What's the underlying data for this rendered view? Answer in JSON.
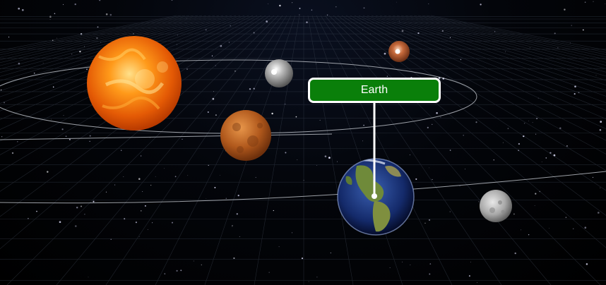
{
  "label": {
    "text": "Earth"
  },
  "colors": {
    "label_background": "#0a7f0a",
    "label_border": "#ffffff",
    "leader_line": "#ffffff",
    "orbit": "#cfd3da",
    "grid": "#3a4250",
    "space": "#000000"
  },
  "bodies": [
    {
      "name": "sun",
      "icon": "sun-icon"
    },
    {
      "name": "mercury",
      "icon": "planet-mercury-icon"
    },
    {
      "name": "venus",
      "icon": "planet-venus-icon"
    },
    {
      "name": "earth",
      "icon": "planet-earth-icon"
    },
    {
      "name": "mars",
      "icon": "planet-mars-icon"
    },
    {
      "name": "moon",
      "icon": "moon-icon"
    }
  ]
}
